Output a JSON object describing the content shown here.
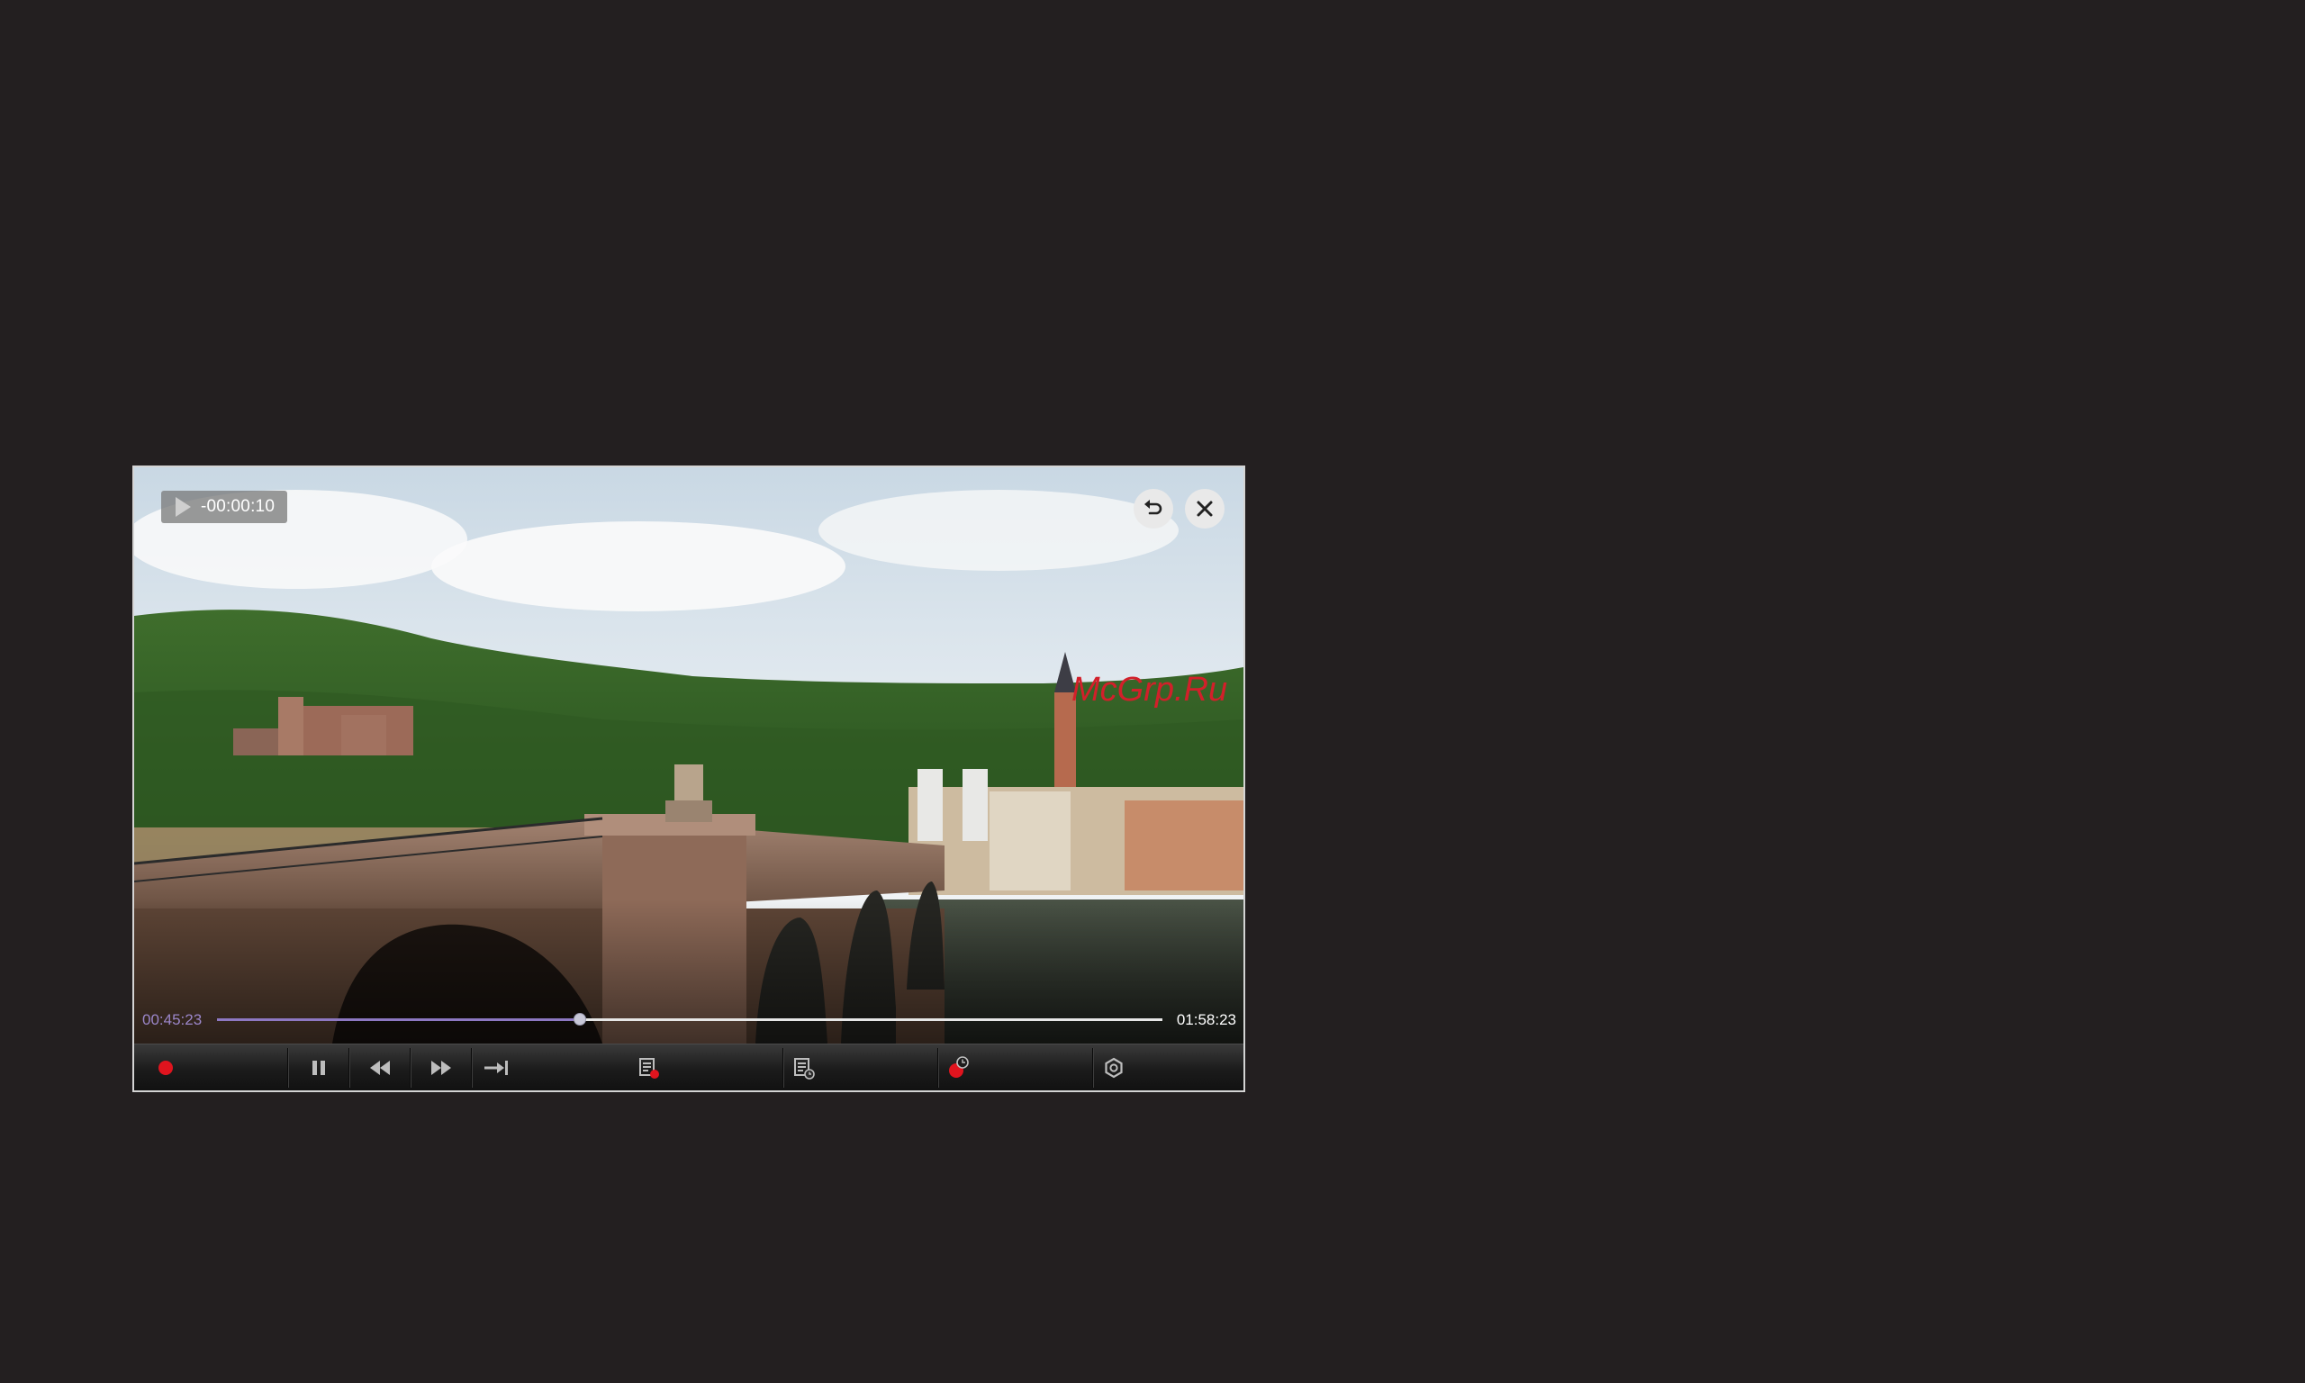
{
  "player": {
    "skip_indicator": {
      "icon": "play-icon",
      "text": "-00:00:10"
    },
    "buttons": {
      "back": "back-icon",
      "close": "close-icon"
    },
    "watermark": "McGrp.Ru",
    "progress": {
      "current": "00:45:23",
      "total": "01:58:23",
      "position_fraction": 0.384
    },
    "controls": [
      {
        "id": "record",
        "icon": "record-icon"
      },
      {
        "id": "pause",
        "icon": "pause-icon"
      },
      {
        "id": "rewind",
        "icon": "rewind-icon"
      },
      {
        "id": "fast-forward",
        "icon": "fast-forward-icon"
      },
      {
        "id": "skip-to-end",
        "icon": "skip-to-end-icon"
      },
      {
        "id": "recordings-list",
        "icon": "recordings-list-icon"
      },
      {
        "id": "schedule-list",
        "icon": "schedule-list-icon"
      },
      {
        "id": "scheduled-record",
        "icon": "scheduled-record-icon"
      },
      {
        "id": "settings",
        "icon": "settings-icon"
      }
    ],
    "colors": {
      "progress_fill": "#8d78c2",
      "current_time": "#9b86c9",
      "record": "#e0141e",
      "watermark": "#d2202a"
    }
  }
}
